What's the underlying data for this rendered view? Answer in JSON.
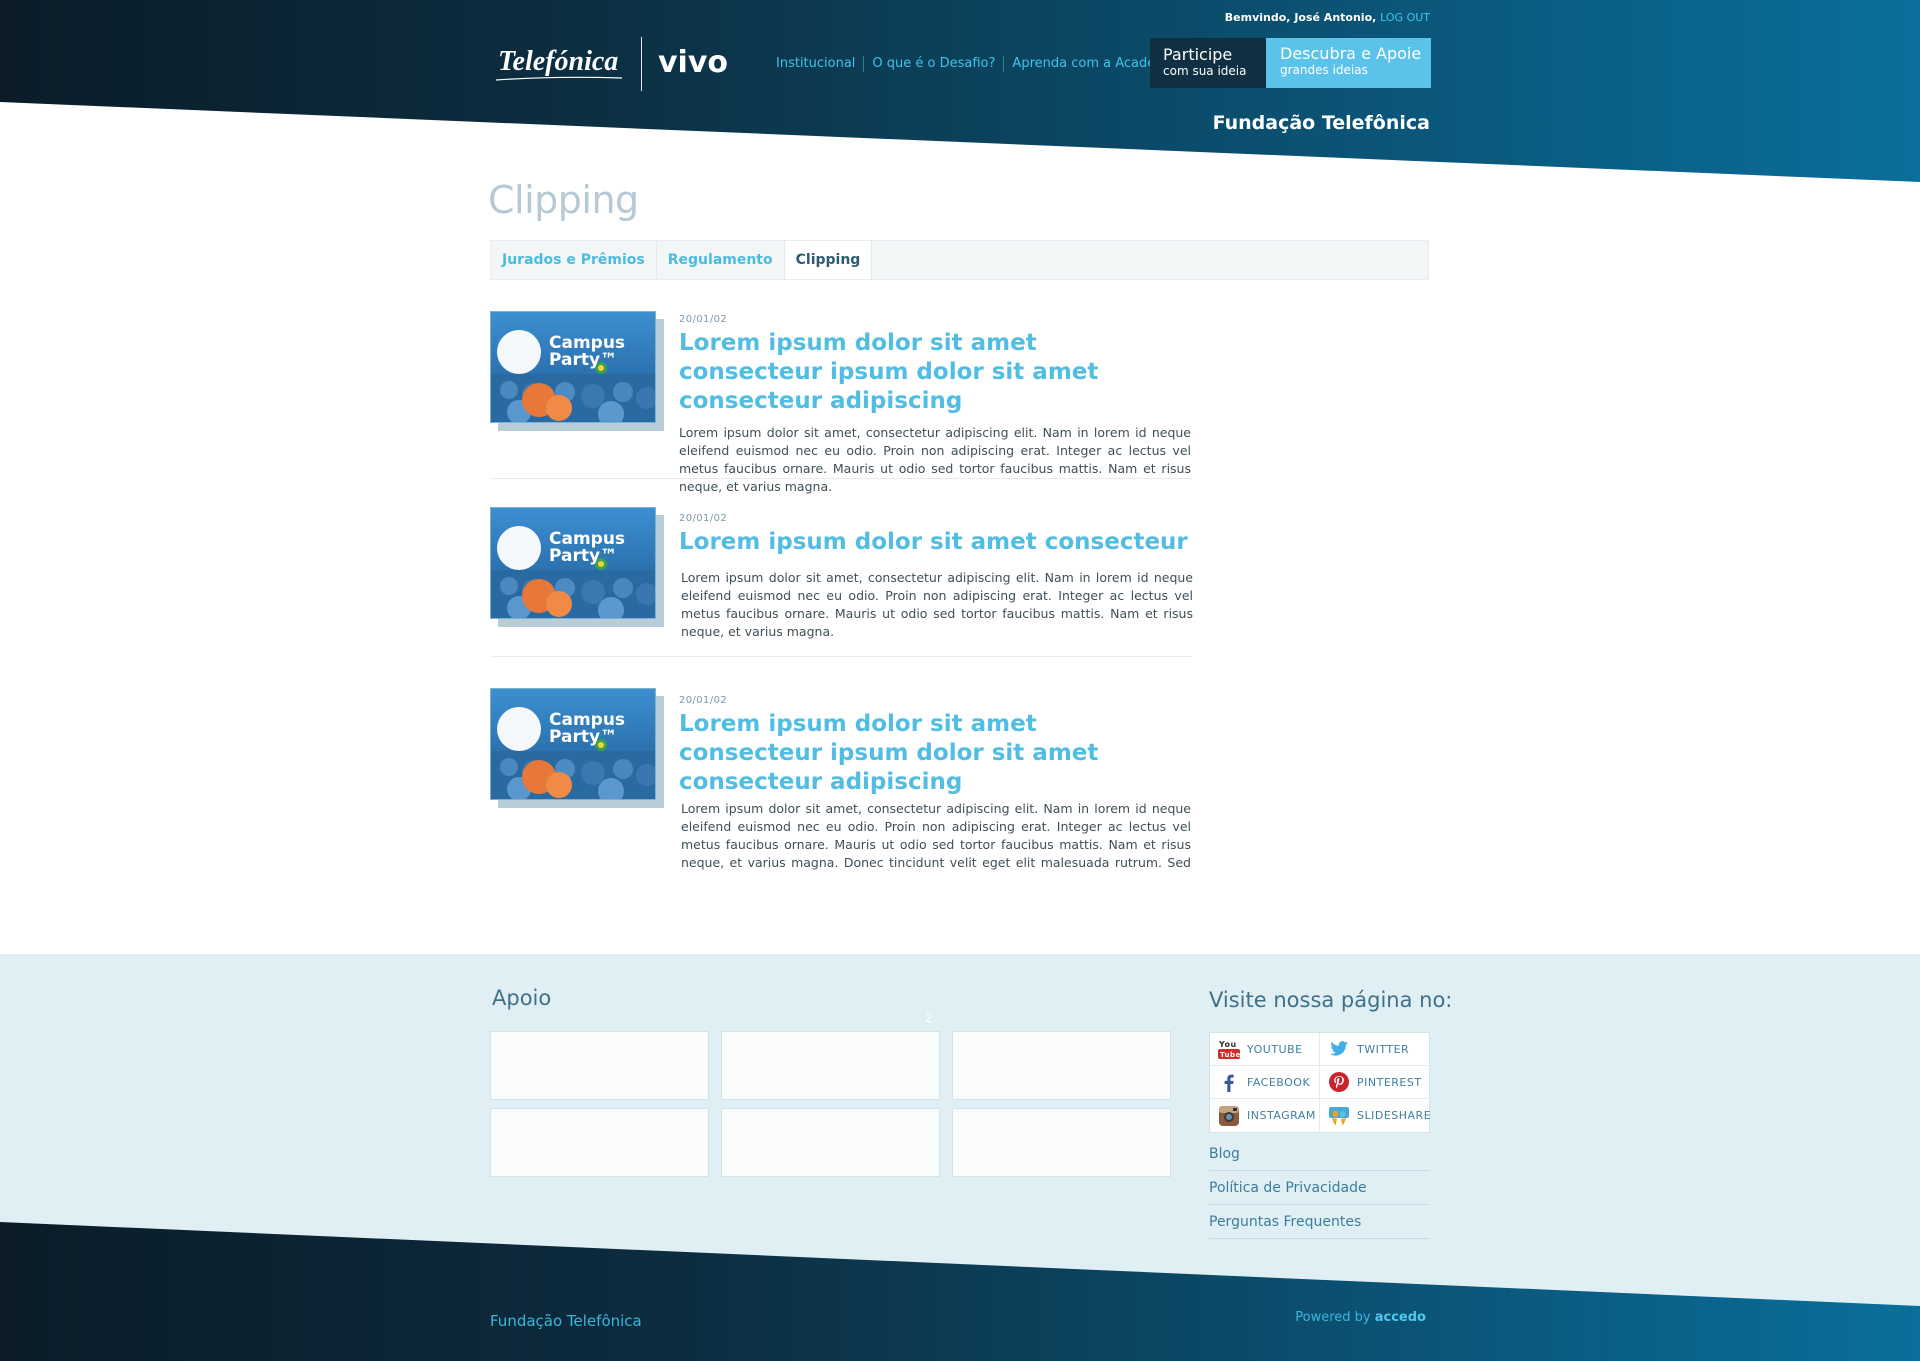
{
  "header": {
    "welcome_text": "Bemvindo, José Antonio,",
    "logout_label": "LOG OUT",
    "logo_telefonica": "Telefónica",
    "logo_vivo": "vivo",
    "nav": [
      "Institucional",
      "O que é o Desafio?",
      "Aprenda com a Academia"
    ],
    "participe": {
      "title": "Participe",
      "subtitle": "com sua ideia"
    },
    "descubra": {
      "title": "Descubra e Apoie",
      "subtitle": "grandes ideias"
    },
    "fundacao": "Fundação Telefônica"
  },
  "page": {
    "title": "Clipping",
    "tabs": [
      "Jurados e Prêmios",
      "Regulamento",
      "Clipping"
    ],
    "active_tab": "Clipping"
  },
  "articles": [
    {
      "date": "20/01/02",
      "title": "Lorem ipsum dolor sit amet consecteur ipsum dolor sit amet consecteur adipiscing",
      "text": "Lorem ipsum dolor sit amet, consectetur adipiscing elit. Nam in lorem id neque eleifend euismod nec eu odio. Proin non adipiscing erat. Integer ac lectus vel metus faucibus ornare. Mauris ut odio sed tortor faucibus mattis. Nam et risus neque, et varius magna.",
      "thumb_text": "Campus Party™"
    },
    {
      "date": "20/01/02",
      "title": "Lorem ipsum dolor sit amet consecteur",
      "text": "Lorem ipsum dolor sit amet, consectetur adipiscing elit. Nam in lorem id neque eleifend euismod nec eu odio. Proin non adipiscing erat. Integer ac lectus vel metus faucibus ornare. Mauris ut odio sed tortor faucibus mattis. Nam et risus neque, et varius magna.",
      "thumb_text": "Campus Party™"
    },
    {
      "date": "20/01/02",
      "title": "Lorem ipsum dolor sit amet consecteur ipsum dolor sit amet consecteur adipiscing",
      "text": "Lorem ipsum dolor sit amet, consectetur adipiscing elit. Nam in lorem id neque eleifend euismod nec eu odio. Proin non adipiscing erat. Integer ac lectus vel metus faucibus ornare. Mauris ut odio sed tortor faucibus mattis. Nam et risus neque, et varius magna. Donec tincidunt velit eget elit malesuada rutrum. Sed nec erat a lectus convallis",
      "thumb_text": "Campus Party™"
    }
  ],
  "footer": {
    "apoio_title": "Apoio",
    "apoio_number": "2",
    "visit_title": "Visite nossa página no:",
    "social": [
      {
        "label": "YOUTUBE",
        "icon": "youtube-icon",
        "color": "#d62b2b"
      },
      {
        "label": "TWITTER",
        "icon": "twitter-icon",
        "color": "#3fb1e8"
      },
      {
        "label": "FACEBOOK",
        "icon": "facebook-icon",
        "color": "#3b5998"
      },
      {
        "label": "PINTEREST",
        "icon": "pinterest-icon",
        "color": "#c8232c"
      },
      {
        "label": "INSTAGRAM",
        "icon": "instagram-icon",
        "color": "#8a5a3c"
      },
      {
        "label": "SLIDESHARE",
        "icon": "slideshare-icon",
        "color": "#f3a21b"
      }
    ],
    "links": [
      "Blog",
      "Política de Privacidade",
      "Perguntas Frequentes"
    ],
    "brand": "Fundação Telefônica",
    "powered_prefix": "Powered by",
    "powered_brand": "accedo"
  },
  "colors": {
    "header_dark": "#0b1c28",
    "header_blue": "#0a6b96",
    "accent": "#52bde3",
    "footer_light": "#ddeef2"
  }
}
